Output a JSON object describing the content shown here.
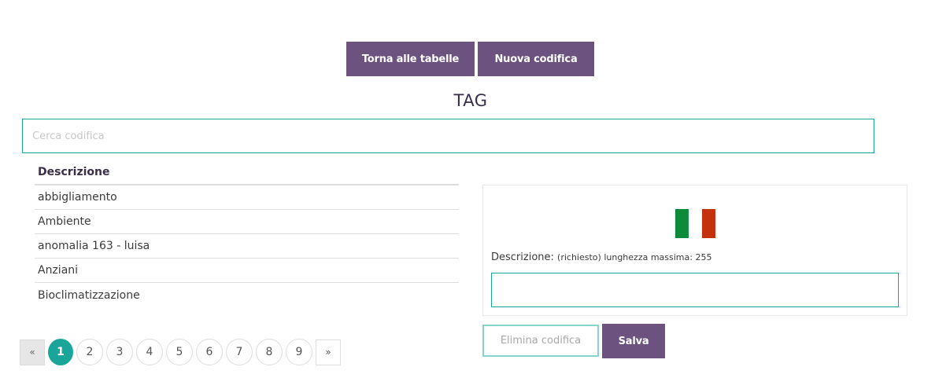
{
  "toolbar": {
    "back_label": "Torna alle tabelle",
    "new_label": "Nuova codifica"
  },
  "title": "TAG",
  "search": {
    "placeholder": "Cerca codifica",
    "value": ""
  },
  "table": {
    "header": "Descrizione",
    "rows": [
      "abbigliamento",
      "Ambiente",
      "anomalia 163 - luisa",
      "Anziani",
      "Bioclimatizzazione"
    ]
  },
  "pagination": {
    "prev": "«",
    "next": "»",
    "pages": [
      "1",
      "2",
      "3",
      "4",
      "5",
      "6",
      "7",
      "8",
      "9"
    ],
    "current": 1
  },
  "form": {
    "flag": "italy-flag",
    "label": "Descrizione:",
    "hint": "(richiesto) lunghezza massima: 255",
    "value": ""
  },
  "actions": {
    "delete_label": "Elimina codifica",
    "save_label": "Salva"
  },
  "colors": {
    "accent": "#1aa59a",
    "primary": "#6b527f"
  }
}
